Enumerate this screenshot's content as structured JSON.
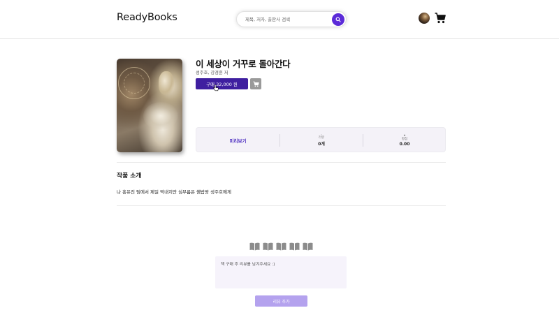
{
  "header": {
    "logo": "ReadyBooks",
    "search_placeholder": "제목, 저자, 출판사 검색"
  },
  "book": {
    "title": "이 세상이 거꾸로 돌아간다",
    "author": "성주호, 강경훈 저",
    "buy_label": "구매 32,000 원",
    "preview_label": "미리보기",
    "review_label": "리뷰",
    "review_count": "0개",
    "rating_label": "평점",
    "rating_value": "0.00"
  },
  "intro": {
    "heading": "작품 소개",
    "text": "나 홍유진 팀에서 제일 막내지만 심부름은 쌤밥왕 성주호에게"
  },
  "review_form": {
    "rating_icons": 5,
    "placeholder": "책 구매 후 리뷰를 남겨주세요 :)",
    "submit_label": "리뷰 추가"
  },
  "colors": {
    "accent": "#3f1fa0",
    "search_button": "#5b2bd8",
    "submit_button": "#b4a2ee",
    "stats_background": "#f4f2f8"
  }
}
